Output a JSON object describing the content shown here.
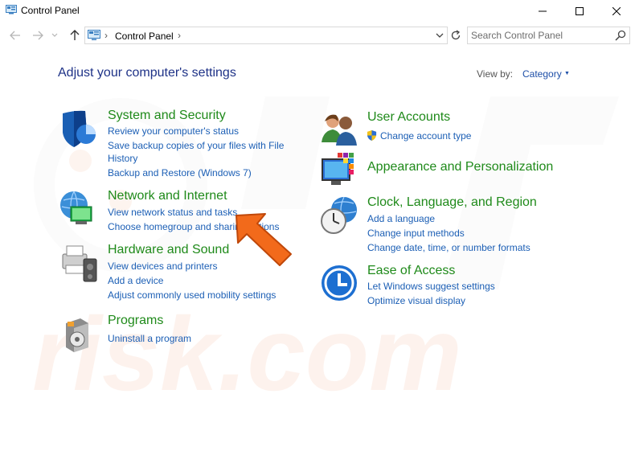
{
  "window": {
    "title": "Control Panel"
  },
  "address": {
    "crumb": "Control Panel",
    "search_placeholder": "Search Control Panel"
  },
  "content": {
    "heading": "Adjust your computer's settings",
    "view_by_label": "View by:",
    "view_by_value": "Category"
  },
  "categories": {
    "system": {
      "title": "System and Security",
      "links": [
        "Review your computer's status",
        "Save backup copies of your files with File",
        "History",
        "Backup and Restore (Windows 7)"
      ]
    },
    "network": {
      "title": "Network and Internet",
      "links": [
        "View network status and tasks",
        "Choose homegroup and sharing options"
      ]
    },
    "hardware": {
      "title": "Hardware and Sound",
      "links": [
        "View devices and printers",
        "Add a device",
        "Adjust commonly used mobility settings"
      ]
    },
    "programs": {
      "title": "Programs",
      "links": [
        "Uninstall a program"
      ]
    },
    "accounts": {
      "title": "User Accounts",
      "links": [
        "Change account type"
      ]
    },
    "appearance": {
      "title": "Appearance and Personalization",
      "links": []
    },
    "clock": {
      "title": "Clock, Language, and Region",
      "links": [
        "Add a language",
        "Change input methods",
        "Change date, time, or number formats"
      ]
    },
    "ease": {
      "title": "Ease of Access",
      "links": [
        "Let Windows suggest settings",
        "Optimize visual display"
      ]
    }
  },
  "watermark": {
    "text": "risk.com"
  },
  "colors": {
    "heading": "#1e3287",
    "category_title": "#1f8a1a",
    "link": "#1c5fb5",
    "arrow": "#f26a1b"
  }
}
